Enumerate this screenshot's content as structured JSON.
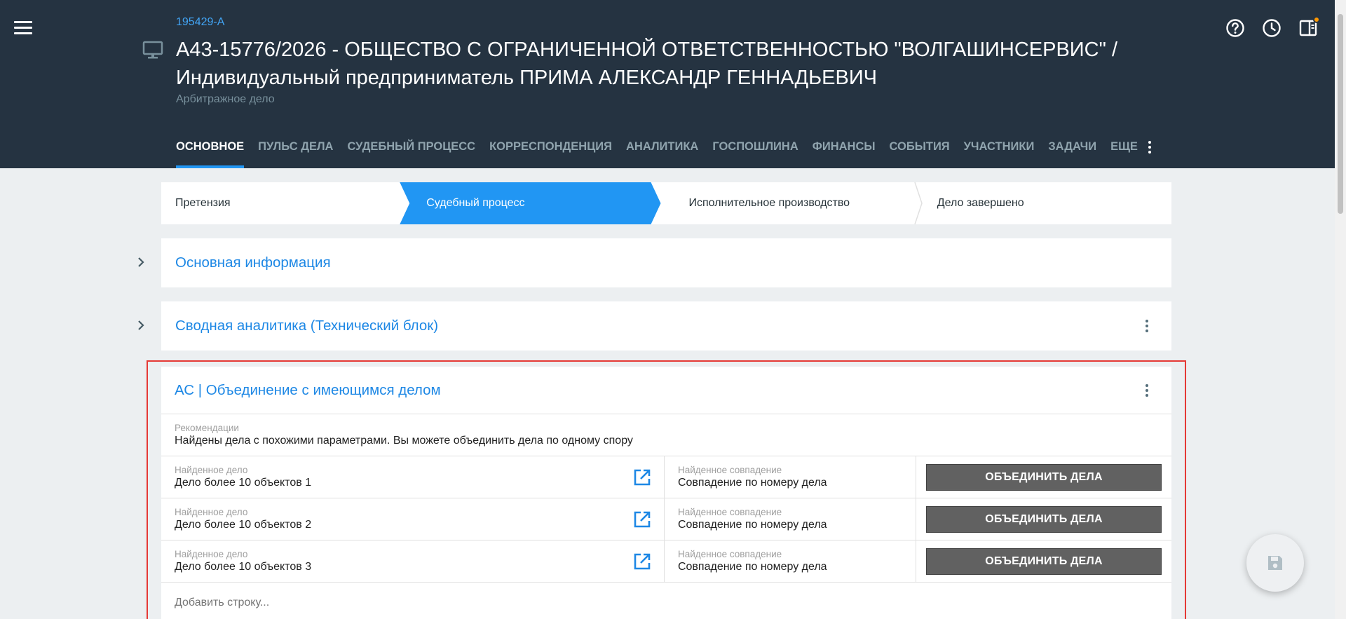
{
  "header": {
    "case_id": "195429-А",
    "title": "А43-15776/2026 - ОБЩЕСТВО С ОГРАНИЧЕННОЙ ОТВЕТСТВЕННОСТЬЮ \"ВОЛГАШИНСЕРВИС\" / Индивидуальный предприниматель ПРИМА АЛЕКСАНДР ГЕННАДЬЕВИЧ",
    "subtitle": "Арбитражное дело",
    "icons": [
      "help-icon",
      "history-icon",
      "side-panel-icon"
    ]
  },
  "tabs": [
    {
      "label": "ОСНОВНОЕ",
      "active": true
    },
    {
      "label": "ПУЛЬС ДЕЛА"
    },
    {
      "label": "СУДЕБНЫЙ ПРОЦЕСС"
    },
    {
      "label": "КОРРЕСПОНДЕНЦИЯ"
    },
    {
      "label": "АНАЛИТИКА"
    },
    {
      "label": "ГОСПОШЛИНА"
    },
    {
      "label": "ФИНАНСЫ"
    },
    {
      "label": "СОБЫТИЯ"
    },
    {
      "label": "УЧАСТНИКИ"
    },
    {
      "label": "ЗАДАЧИ"
    },
    {
      "label": "ЕЩЕ"
    }
  ],
  "stages": [
    {
      "label": "Претензия"
    },
    {
      "label": "Судебный процесс",
      "active": true
    },
    {
      "label": "Исполнительное производство"
    },
    {
      "label": "Дело завершено"
    }
  ],
  "panels": {
    "main_info": "Основная информация",
    "analytics": "Сводная аналитика (Технический блок)"
  },
  "merge_card": {
    "title": "АС | Объединение с имеющимся делом",
    "rec_label": "Рекомендации",
    "rec_text": "Найдены дела с похожими параметрами. Вы можете объединить дела по одному спору",
    "rows": [
      {
        "case_label": "Найденное дело",
        "case_value": "Дело более 10 объектов 1",
        "match_label": "Найденное совпадение",
        "match_value": "Совпадение по номеру дела",
        "button": "ОБЪЕДИНИТЬ ДЕЛА"
      },
      {
        "case_label": "Найденное дело",
        "case_value": "Дело более 10 объектов 2",
        "match_label": "Найденное совпадение",
        "match_value": "Совпадение по номеру дела",
        "button": "ОБЪЕДИНИТЬ ДЕЛА"
      },
      {
        "case_label": "Найденное дело",
        "case_value": "Дело более 10 объектов 3",
        "match_label": "Найденное совпадение",
        "match_value": "Совпадение по номеру дела",
        "button": "ОБЪЕДИНИТЬ ДЕЛА"
      }
    ],
    "add_row": "Добавить строку..."
  },
  "colors": {
    "header_bg": "#253341",
    "accent": "#2196f3",
    "link": "#1e88e5",
    "button_bg": "#616161",
    "focus_border": "#e53935",
    "notification": "#ff9800"
  }
}
